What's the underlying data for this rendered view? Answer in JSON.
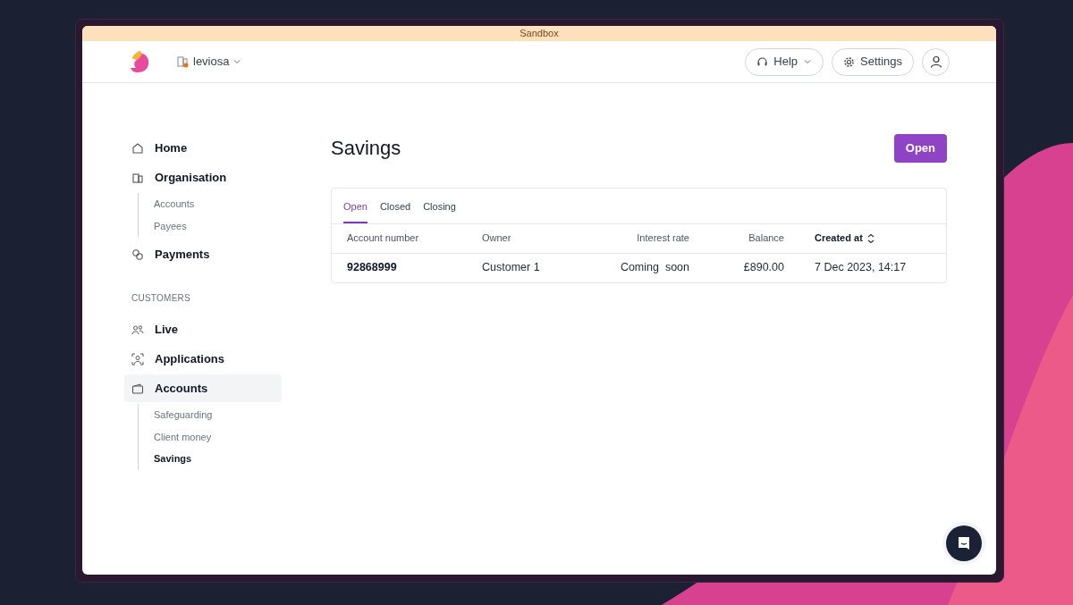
{
  "banner": {
    "label": "Sandbox"
  },
  "header": {
    "workspace": "leviosa",
    "help": "Help",
    "settings": "Settings"
  },
  "nav": [
    {
      "items": [
        {
          "label": "Home",
          "selected": false
        },
        {
          "label": "Organisation",
          "selected": false,
          "children": [
            {
              "label": "Accounts",
              "selected": false
            },
            {
              "label": "Payees",
              "selected": false
            }
          ]
        },
        {
          "label": "Payments",
          "selected": false
        }
      ]
    },
    {
      "heading": "CUSTOMERS",
      "items": [
        {
          "label": "Live",
          "selected": false
        },
        {
          "label": "Applications",
          "selected": false
        },
        {
          "label": "Accounts",
          "selected": true,
          "children": [
            {
              "label": "Safeguarding",
              "selected": false
            },
            {
              "label": "Client money",
              "selected": false
            },
            {
              "label": "Savings",
              "selected": true
            }
          ]
        }
      ]
    }
  ],
  "page": {
    "title": "Savings",
    "action": "Open"
  },
  "tabs": [
    {
      "label": "Open",
      "selected": true
    },
    {
      "label": "Closed",
      "selected": false
    },
    {
      "label": "Closing",
      "selected": false
    }
  ],
  "table": {
    "columns": [
      {
        "label": "Account number",
        "sortable": false
      },
      {
        "label": "Owner",
        "sortable": false
      },
      {
        "label": "Interest rate",
        "sortable": false
      },
      {
        "label": "Balance",
        "sortable": false
      },
      {
        "label": "Created at",
        "sortable": true
      }
    ],
    "rows": [
      [
        "92868999",
        "Customer 1",
        "Coming  soon",
        "£890.00",
        "7 Dec 2023, 14:17"
      ]
    ]
  }
}
